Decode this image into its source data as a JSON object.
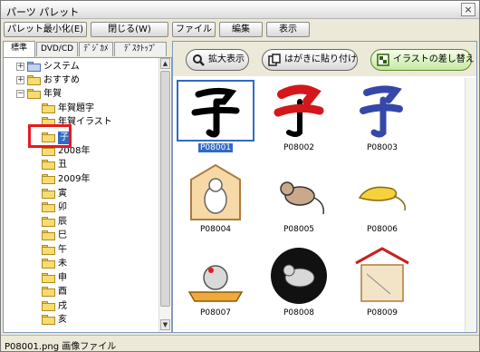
{
  "window": {
    "title": "パーツ パレット"
  },
  "toolbar": {
    "minimize_label": "パレット最小化(E)",
    "close_label": "閉じる(W)",
    "menus": [
      "ファイル",
      "編集",
      "表示"
    ]
  },
  "tabs": [
    "標準",
    "DVD/CD",
    "ﾃﾞｼﾞｶﾒ",
    "ﾃﾞｽｸﾄｯﾌﾟ"
  ],
  "tree": {
    "items": [
      {
        "label": "システム",
        "expander": "+"
      },
      {
        "label": "おすすめ",
        "expander": "+"
      },
      {
        "label": "年賀",
        "expander": "−"
      },
      {
        "label": "年賀題字"
      },
      {
        "label": "年賀イラスト"
      },
      {
        "label": "子"
      },
      {
        "label": "2008年"
      },
      {
        "label": "丑"
      },
      {
        "label": "2009年"
      },
      {
        "label": "寅"
      },
      {
        "label": "卯"
      },
      {
        "label": "辰"
      },
      {
        "label": "巳"
      },
      {
        "label": "午"
      },
      {
        "label": "未"
      },
      {
        "label": "申"
      },
      {
        "label": "酉"
      },
      {
        "label": "戌"
      },
      {
        "label": "亥"
      }
    ]
  },
  "actions": {
    "zoom_label": "拡大表示",
    "paste_label": "はがきに貼り付け",
    "replace_label": "イラストの差し替え"
  },
  "grid": {
    "items": [
      {
        "name": "P08001",
        "icon": "kanji-ko-black-brush"
      },
      {
        "name": "P08002",
        "icon": "kanji-ko-red-brush"
      },
      {
        "name": "P08003",
        "icon": "kanji-ko-blue-brush"
      },
      {
        "name": "P08004",
        "icon": "ema-mouse"
      },
      {
        "name": "P08005",
        "icon": "mouse-sketch"
      },
      {
        "name": "P08006",
        "icon": "yellow-mouse"
      },
      {
        "name": "P08007",
        "icon": "mouse-on-mat"
      },
      {
        "name": "P08008",
        "icon": "mouse-black-circle"
      },
      {
        "name": "P08009",
        "icon": "ema-red-roof"
      }
    ]
  },
  "status": {
    "text": "P08001.png 画像ファイル"
  },
  "colors": {
    "selection": "#316ac5",
    "highlight_box": "#e8191c",
    "accent_green": "#5b8a2b"
  }
}
